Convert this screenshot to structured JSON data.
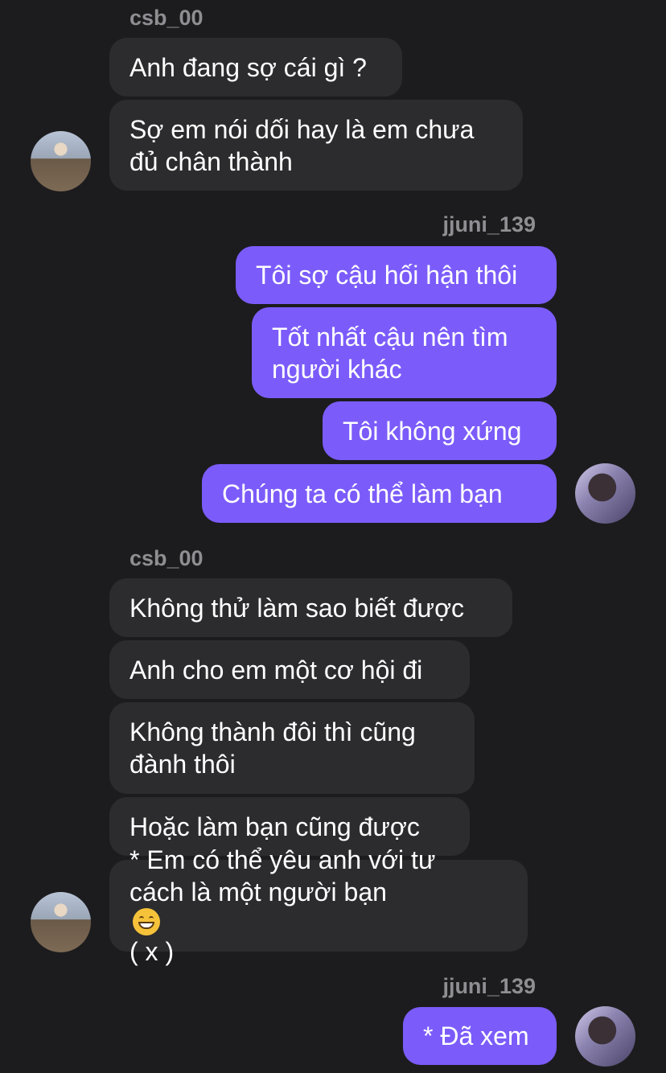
{
  "senders": {
    "other": "csb_00",
    "me": "jjuni_139"
  },
  "messages": {
    "g1": [
      "Anh đang sợ cái gì ?",
      "Sợ em nói dối hay là em chưa",
      "đủ chân thành"
    ],
    "g2": [
      "Tôi sợ cậu hối hận thôi",
      "Tốt nhất cậu nên tìm",
      "người khác",
      "Tôi không xứng",
      "Chúng ta có thể làm bạn"
    ],
    "g3": [
      "Không thử làm sao biết được",
      "Anh cho em một cơ hội đi",
      "Không thành đôi thì cũng",
      "đành thôi",
      "Hoặc làm bạn cũng được",
      "* Em có thể yêu anh với tư",
      "cách là một người bạn",
      "( x )"
    ],
    "g4": [
      "* Đã xem"
    ]
  },
  "icons": {
    "emoji": "grinning-face-emoji"
  },
  "colors": {
    "background": "#1c1c1e",
    "incoming_bubble": "#2c2c2e",
    "outgoing_bubble": "#7b5cfa"
  }
}
